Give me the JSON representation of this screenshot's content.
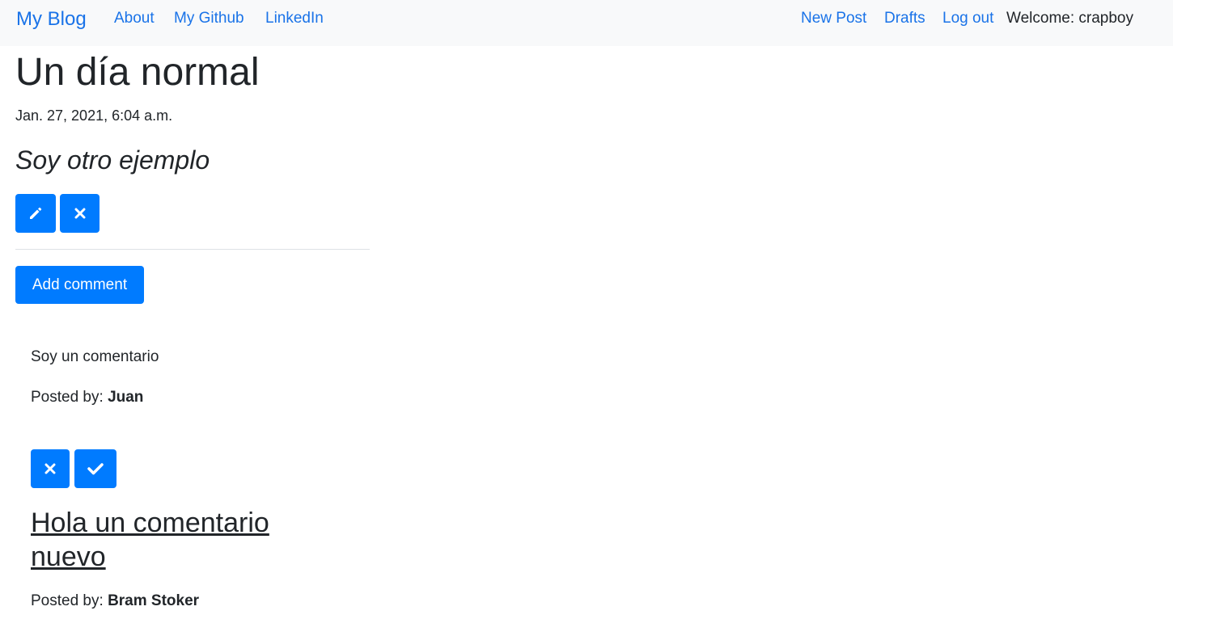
{
  "navbar": {
    "brand": "My Blog",
    "links": [
      "About",
      "My Github",
      "LinkedIn"
    ],
    "right_links": [
      "New Post",
      "Drafts",
      "Log out"
    ],
    "welcome": "Welcome: crapboy"
  },
  "post": {
    "title": "Un día normal",
    "date": "Jan. 27, 2021, 6:04 a.m.",
    "body": "Soy otro ejemplo",
    "edit_icon": "pencil-icon",
    "delete_icon": "close-icon"
  },
  "actions": {
    "add_comment_label": "Add comment"
  },
  "comments": [
    {
      "text": "Soy un comentario",
      "posted_by_label": "Posted by:",
      "author": "Juan",
      "remove_icon": "close-icon",
      "approve_icon": "check-icon"
    },
    {
      "text": "Hola un comentario nuevo",
      "posted_by_label": "Posted by:",
      "author": "Bram Stoker"
    }
  ],
  "colors": {
    "accent": "#007bff",
    "link": "#1a73e8",
    "navbar_bg": "#f8f9fa",
    "text": "#212529"
  }
}
